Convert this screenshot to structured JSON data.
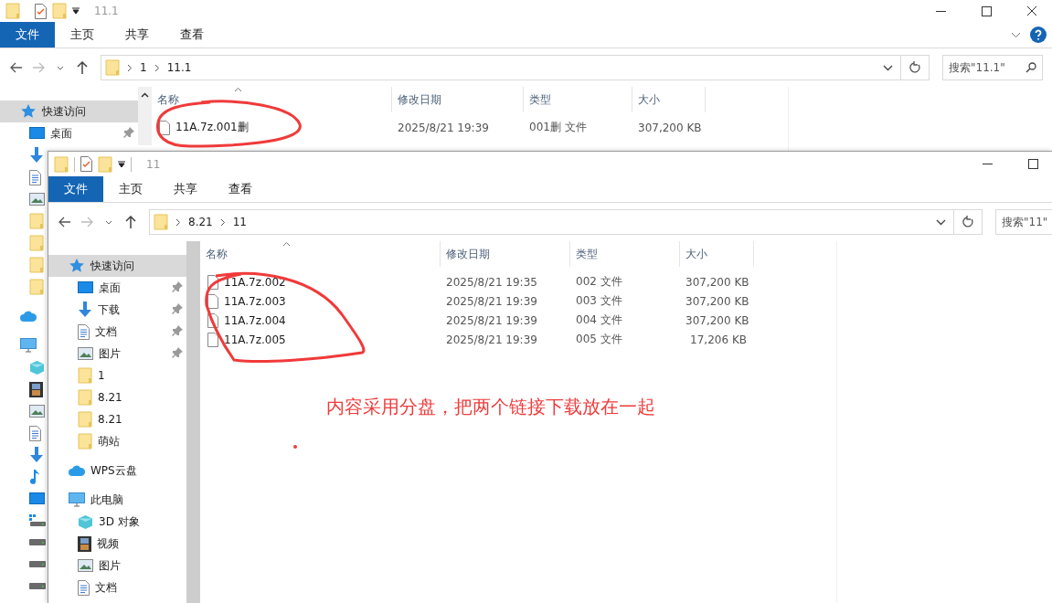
{
  "windows": [
    {
      "title": "11.1",
      "ribbon_tabs": [
        {
          "label": "文件",
          "selected": true
        },
        {
          "label": "主页",
          "selected": false
        },
        {
          "label": "共享",
          "selected": false
        },
        {
          "label": "查看",
          "selected": false
        }
      ],
      "path": [
        "1",
        "11.1"
      ],
      "search": {
        "placeholder": "搜索\"11.1\""
      },
      "nav": [
        {
          "label": "快速访问",
          "kind": "star",
          "selected": true,
          "children": [
            {
              "label": "桌面",
              "kind": "desktop",
              "selected": false,
              "pinned": true
            },
            {
              "kind": "download",
              "selected": false
            },
            {
              "kind": "document",
              "selected": false
            },
            {
              "kind": "picture",
              "selected": false
            },
            {
              "kind": "folder",
              "selected": false
            },
            {
              "kind": "folder",
              "selected": false
            },
            {
              "kind": "folder",
              "selected": false
            },
            {
              "kind": "folder",
              "selected": false
            }
          ]
        },
        {
          "kind": "cloud",
          "selected": false
        },
        {
          "kind": "pc",
          "selected": false,
          "children": [
            {
              "kind": "cube",
              "selected": false
            },
            {
              "kind": "video",
              "selected": false
            },
            {
              "kind": "picture",
              "selected": false
            },
            {
              "kind": "document",
              "selected": false
            },
            {
              "kind": "download",
              "selected": false
            },
            {
              "kind": "music",
              "selected": false
            },
            {
              "kind": "desktop",
              "selected": false
            },
            {
              "kind": "drive-win",
              "selected": false
            },
            {
              "kind": "drive",
              "selected": false
            },
            {
              "kind": "drive",
              "selected": false
            },
            {
              "kind": "drive",
              "selected": false
            }
          ]
        }
      ],
      "columns": [
        "名称",
        "修改日期",
        "类型",
        "大小"
      ],
      "files": [
        {
          "name": "11A.7z.001删",
          "modified": "2025/8/21 19:39",
          "type": "001删 文件",
          "size": "307,200 KB"
        }
      ]
    },
    {
      "title": "11",
      "ribbon_tabs": [
        {
          "label": "文件",
          "selected": true
        },
        {
          "label": "主页",
          "selected": false
        },
        {
          "label": "共享",
          "selected": false
        },
        {
          "label": "查看",
          "selected": false
        }
      ],
      "path": [
        "8.21",
        "11"
      ],
      "search": {
        "placeholder": "搜索\"11\""
      },
      "nav": [
        {
          "label": "快速访问",
          "kind": "star",
          "selected": true,
          "children": [
            {
              "label": "桌面",
              "kind": "desktop",
              "selected": false,
              "pinned": true
            },
            {
              "label": "下载",
              "kind": "download",
              "selected": false,
              "pinned": true
            },
            {
              "label": "文档",
              "kind": "document",
              "selected": false,
              "pinned": true
            },
            {
              "label": "图片",
              "kind": "picture",
              "selected": false,
              "pinned": true
            },
            {
              "label": "1",
              "kind": "folder",
              "selected": false,
              "pinned": false
            },
            {
              "label": "8.21",
              "kind": "folder",
              "selected": false,
              "pinned": false
            },
            {
              "label": "8.21",
              "kind": "folder",
              "selected": false,
              "pinned": false
            },
            {
              "label": "萌站",
              "kind": "folder",
              "selected": false,
              "pinned": false
            }
          ]
        },
        {
          "label": "WPS云盘",
          "kind": "cloud",
          "selected": false
        },
        {
          "label": "此电脑",
          "kind": "pc",
          "selected": false,
          "children": [
            {
              "label": "3D 对象",
              "kind": "cube",
              "selected": false
            },
            {
              "label": "视频",
              "kind": "video",
              "selected": false
            },
            {
              "label": "图片",
              "kind": "picture",
              "selected": false
            },
            {
              "label": "文档",
              "kind": "document",
              "selected": false
            }
          ]
        }
      ],
      "columns": [
        "名称",
        "修改日期",
        "类型",
        "大小"
      ],
      "files": [
        {
          "name": "11A.7z.002",
          "modified": "2025/8/21 19:35",
          "type": "002 文件",
          "size": "307,200 KB"
        },
        {
          "name": "11A.7z.003",
          "modified": "2025/8/21 19:39",
          "type": "003 文件",
          "size": "307,200 KB"
        },
        {
          "name": "11A.7z.004",
          "modified": "2025/8/21 19:39",
          "type": "004 文件",
          "size": "307,200 KB"
        },
        {
          "name": "11A.7z.005",
          "modified": "2025/8/21 19:39",
          "type": "005 文件",
          "size": "17,206 KB"
        }
      ]
    }
  ],
  "annotations": {
    "note": "内容采用分盘，把两个链接下载放在一起"
  }
}
